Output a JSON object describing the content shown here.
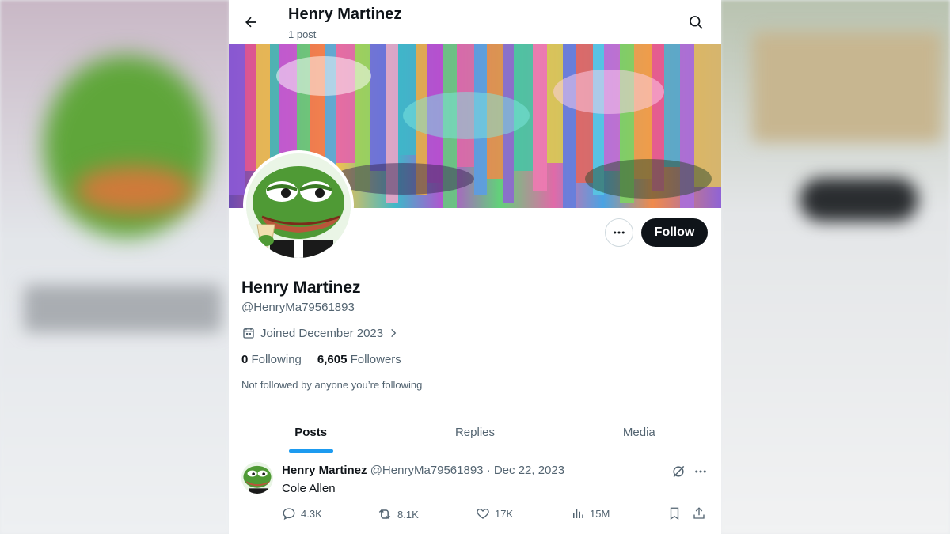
{
  "header": {
    "title": "Henry Martinez",
    "post_count": "1 post"
  },
  "profile": {
    "display_name": "Henry Martinez",
    "handle": "@HenryMa79561893",
    "joined": "Joined December 2023",
    "following_count": "0",
    "following_label": "Following",
    "followers_count": "6,605",
    "followers_label": "Followers",
    "not_followed": "Not followed by anyone you’re following",
    "follow_label": "Follow"
  },
  "tabs": [
    {
      "label": "Posts",
      "active": true
    },
    {
      "label": "Replies",
      "active": false
    },
    {
      "label": "Media",
      "active": false
    }
  ],
  "post": {
    "author": "Henry Martinez",
    "handle_date": "@HenryMa79561893 · Dec 22, 2023",
    "text": "Cole Allen",
    "replies": "4.3K",
    "reposts": "8.1K",
    "likes": "17K",
    "views": "15M"
  },
  "icons": {
    "back": "arrow-left-icon",
    "search": "search-icon",
    "more": "more-horizontal-icon",
    "calendar": "calendar-icon",
    "chevron": "chevron-right-icon",
    "grok": "grok-icon",
    "reply": "reply-icon",
    "repost": "repost-icon",
    "like": "heart-icon",
    "views": "views-chart-icon",
    "bookmark": "bookmark-icon",
    "share": "share-icon"
  },
  "colors": {
    "accent": "#1d9bf0",
    "text_primary": "#0f1419",
    "text_secondary": "#536471",
    "follow_button": "#0f1419"
  }
}
